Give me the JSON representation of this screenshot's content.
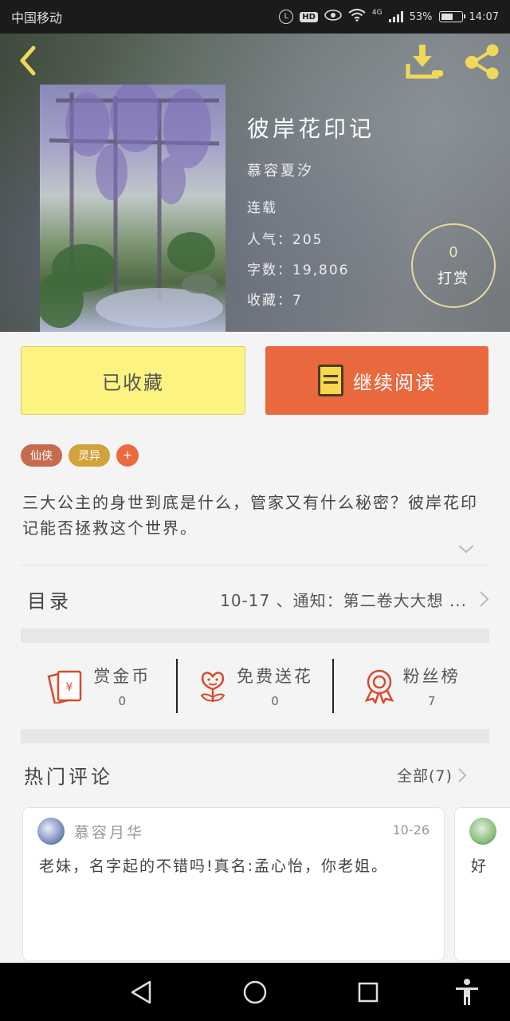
{
  "status_bar": {
    "carrier": "中国移动",
    "network": "4G",
    "battery": "53%",
    "time": "14:07"
  },
  "book": {
    "title": "彼岸花印记",
    "author": "慕容夏汐",
    "status": "连载",
    "popularity": "人气：205",
    "word_count": "字数：19,806",
    "favorites": "收藏：7",
    "tip_count": "0",
    "tip_label": "打赏"
  },
  "actions": {
    "favorited_label": "已收藏",
    "continue_reading_label": "继续阅读"
  },
  "tags": [
    "仙侠",
    "灵异"
  ],
  "tag_add": "+",
  "synopsis": "三大公主的身世到底是什么，管家又有什么秘密？彼岸花印记能否拯救这个世界。",
  "toc": {
    "label": "目录",
    "latest": "10-17 、通知：第二卷大大想 ..."
  },
  "stats": [
    {
      "label": "赏金币",
      "value": "0",
      "icon": "red-envelope-icon"
    },
    {
      "label": "免费送花",
      "value": "0",
      "icon": "flower-icon"
    },
    {
      "label": "粉丝榜",
      "value": "7",
      "icon": "medal-icon"
    }
  ],
  "comments": {
    "title": "热门评论",
    "all_label": "全部(7)",
    "items": [
      {
        "user": "慕容月华",
        "date": "10-26",
        "text": "老妹，名字起的不错吗!真名:孟心怡，你老姐。"
      },
      {
        "user": "",
        "date": "",
        "text": "好"
      }
    ]
  },
  "colors": {
    "favorite_button": "#fdf381",
    "read_button": "#e9683e",
    "tag_xianxia": "#c76a4e",
    "tag_lingyi": "#d2a23d",
    "accent_yellow": "#f0d85a",
    "stat_icon_red": "#d94a2e"
  }
}
